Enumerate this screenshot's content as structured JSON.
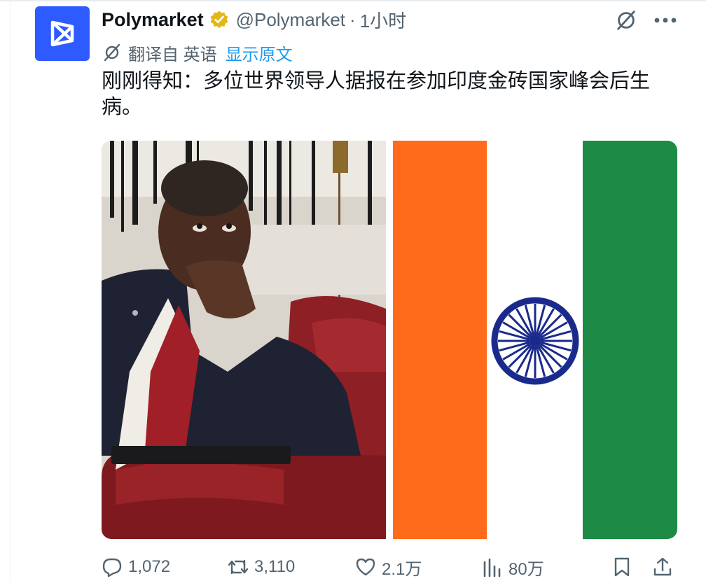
{
  "author": {
    "name": "Polymarket",
    "handle": "@Polymarket",
    "separator": "·",
    "time": "1小时"
  },
  "translation": {
    "label": "翻译自 英语",
    "show_original": "显示原文"
  },
  "tweet_text": "刚刚得知：多位世界领导人据报在参加印度金砖国家峰会后生病。",
  "media": {
    "left_alt": "photo-of-man-sitting-in-red-armchair",
    "right_alt": "flag-of-india"
  },
  "actions": {
    "replies": "1,072",
    "retweets": "3,110",
    "likes": "2.1万",
    "views": "80万"
  },
  "colors": {
    "brand_blue": "#2e5bff",
    "link_blue": "#1d9bf0",
    "muted": "#536471",
    "verified_gold": "#e2b719",
    "flag_orange": "#ff6b1a",
    "flag_green": "#1d8a45",
    "chakra_navy": "#1a2a8c"
  },
  "icons": [
    "polymarket-logo-icon",
    "verified-badge-icon",
    "grok-icon",
    "more-icon",
    "translate-icon",
    "reply-icon",
    "retweet-icon",
    "like-icon",
    "views-icon",
    "bookmark-icon",
    "share-icon"
  ]
}
